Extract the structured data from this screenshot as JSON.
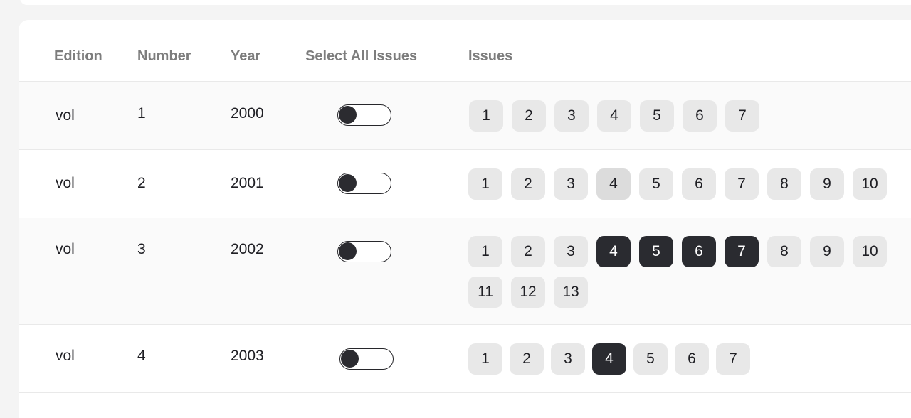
{
  "table": {
    "headers": {
      "edition": "Edition",
      "number": "Number",
      "year": "Year",
      "select_all": "Select All Issues",
      "issues": "Issues"
    },
    "rows": [
      {
        "edition": "vol",
        "number": "1",
        "year": "2000",
        "select_all": false,
        "issues": [
          {
            "label": "1",
            "state": "normal"
          },
          {
            "label": "2",
            "state": "normal"
          },
          {
            "label": "3",
            "state": "normal"
          },
          {
            "label": "4",
            "state": "normal"
          },
          {
            "label": "5",
            "state": "normal"
          },
          {
            "label": "6",
            "state": "normal"
          },
          {
            "label": "7",
            "state": "normal"
          }
        ]
      },
      {
        "edition": "vol",
        "number": "2",
        "year": "2001",
        "select_all": false,
        "issues": [
          {
            "label": "1",
            "state": "normal"
          },
          {
            "label": "2",
            "state": "normal"
          },
          {
            "label": "3",
            "state": "normal"
          },
          {
            "label": "4",
            "state": "hover"
          },
          {
            "label": "5",
            "state": "normal"
          },
          {
            "label": "6",
            "state": "normal"
          },
          {
            "label": "7",
            "state": "normal"
          },
          {
            "label": "8",
            "state": "normal"
          },
          {
            "label": "9",
            "state": "normal"
          },
          {
            "label": "10",
            "state": "normal"
          }
        ]
      },
      {
        "edition": "vol",
        "number": "3",
        "year": "2002",
        "select_all": false,
        "issues": [
          {
            "label": "1",
            "state": "normal"
          },
          {
            "label": "2",
            "state": "normal"
          },
          {
            "label": "3",
            "state": "normal"
          },
          {
            "label": "4",
            "state": "selected"
          },
          {
            "label": "5",
            "state": "selected"
          },
          {
            "label": "6",
            "state": "selected"
          },
          {
            "label": "7",
            "state": "selected"
          },
          {
            "label": "8",
            "state": "normal"
          },
          {
            "label": "9",
            "state": "normal"
          },
          {
            "label": "10",
            "state": "normal"
          },
          {
            "label": "11",
            "state": "normal"
          },
          {
            "label": "12",
            "state": "normal"
          },
          {
            "label": "13",
            "state": "normal"
          }
        ]
      },
      {
        "edition": "vol",
        "number": "4",
        "year": "2003",
        "select_all": false,
        "issues": [
          {
            "label": "1",
            "state": "normal"
          },
          {
            "label": "2",
            "state": "normal"
          },
          {
            "label": "3",
            "state": "normal"
          },
          {
            "label": "4",
            "state": "selected"
          },
          {
            "label": "5",
            "state": "normal"
          },
          {
            "label": "6",
            "state": "normal"
          },
          {
            "label": "7",
            "state": "normal"
          }
        ]
      }
    ]
  },
  "colors": {
    "selected_bg": "#2a2b30",
    "chip_bg": "#e8e8e8",
    "header_text": "#7d7d7d"
  }
}
